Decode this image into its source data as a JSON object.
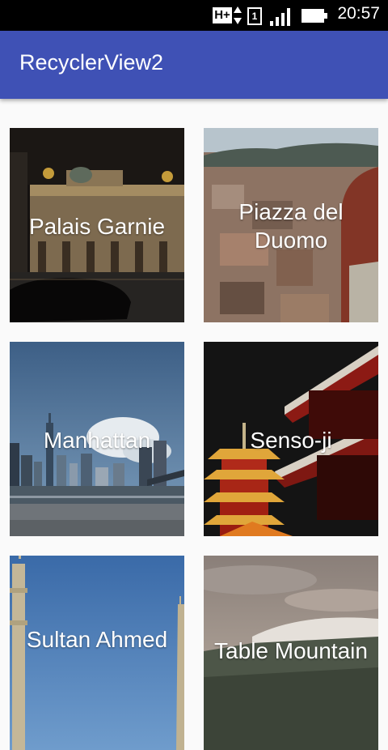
{
  "status_bar": {
    "network_label": "H+",
    "sim_label": "1",
    "time": "20:57"
  },
  "app_bar": {
    "title": "RecyclerView2"
  },
  "colors": {
    "primary": "#3f51b5",
    "status_bar": "#000000",
    "background": "#fafafa"
  },
  "items": [
    {
      "label": "Palais Garnie"
    },
    {
      "label": "Piazza del Duomo"
    },
    {
      "label": "Manhattan"
    },
    {
      "label": "Senso-ji"
    },
    {
      "label": "Sultan Ahmed"
    },
    {
      "label": "Table Mountain"
    }
  ]
}
